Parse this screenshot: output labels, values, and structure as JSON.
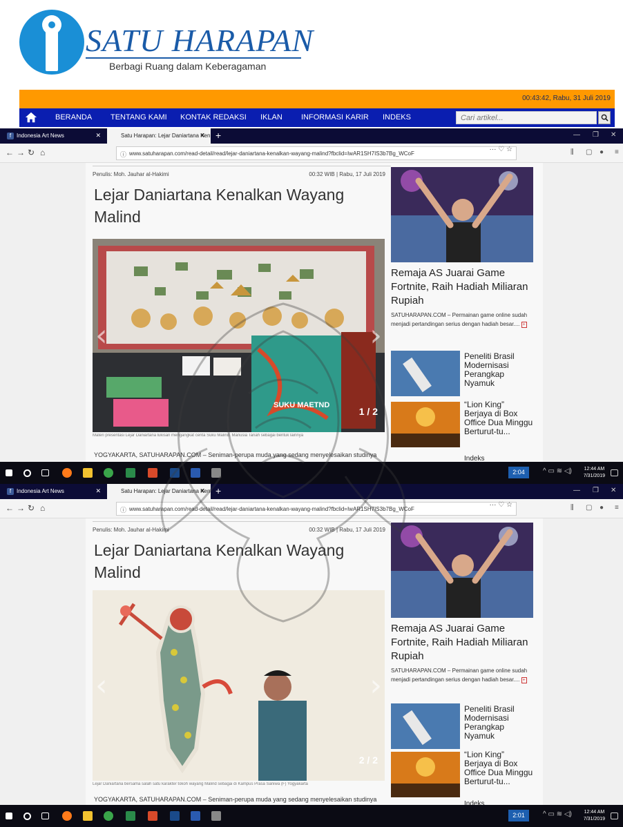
{
  "site": {
    "logo_text": "SATU HARAPAN",
    "tagline": "Berbagi Ruang dalam Keberagaman",
    "datetime": "00:43:42, Rabu, 31 Juli 2019",
    "nav": [
      "BERANDA",
      "TENTANG KAMI",
      "KONTAK REDAKSI",
      "IKLAN",
      "INFORMASI KARIR",
      "INDEKS"
    ],
    "search_placeholder": "Cari artikel..."
  },
  "browser": {
    "tab1_label": "Indonesia Art News",
    "tab2_label": "Satu Harapan: Lejar Daniartana Ken",
    "new_tab": "+",
    "url": "www.satuharapan.com/read-detail/read/lejar-daniartana-kenalkan-wayang-malind?fbclid=IwAR1SH7IS3b7Bg_WCoF"
  },
  "article": {
    "author": "Penulis: Moh. Jauhar al-Hakimi",
    "date": "00:32 WIB | Rabu, 17 Juli 2019",
    "title": "Lejar Daniartana Kenalkan Wayang Malind",
    "caption_1": "Materi presentasi Lejar Daniartana lukisan mengangkat cerita Suku Malind. Manusia Tanah sebagai bentuk lainnya",
    "caption_2": "Lejar Daniartana bersama salah satu karakter tokoh wayang Malind sebagai di Kampus Prasa Saniwa (F) Yogyakarta",
    "slide_1": "1 / 2",
    "slide_2": "2 / 2",
    "book_label": "SUKU MAETND",
    "lead": "YOGYAKARTA, SATUHARAPAN.COM – Seniman-perupa muda yang sedang menyelesaikan studinya"
  },
  "sidebar": {
    "feature_title": "Remaja AS Juarai Game Fortnite, Raih Hadiah Miliaran Rupiah",
    "feature_desc": "SATUHARAPAN.COM – Permainan game online sudah menjadi pertandingan serius dengan hadiah besar....",
    "item1": "Peneliti Brasil Modernisasi Perangkap Nyamuk",
    "item2": "“Lion King” Berjaya di Box Office Dua Minggu Berturut-tu...",
    "indeks": "Indeks"
  },
  "taskbar": {
    "badge": "2:04",
    "badge_2": "2:01",
    "time": "12:44 AM",
    "date": "7/31/2019"
  },
  "colors": {
    "brand_blue": "#0a1eb0",
    "orange": "#ff9900",
    "logo_blue": "#1a8fd6"
  }
}
